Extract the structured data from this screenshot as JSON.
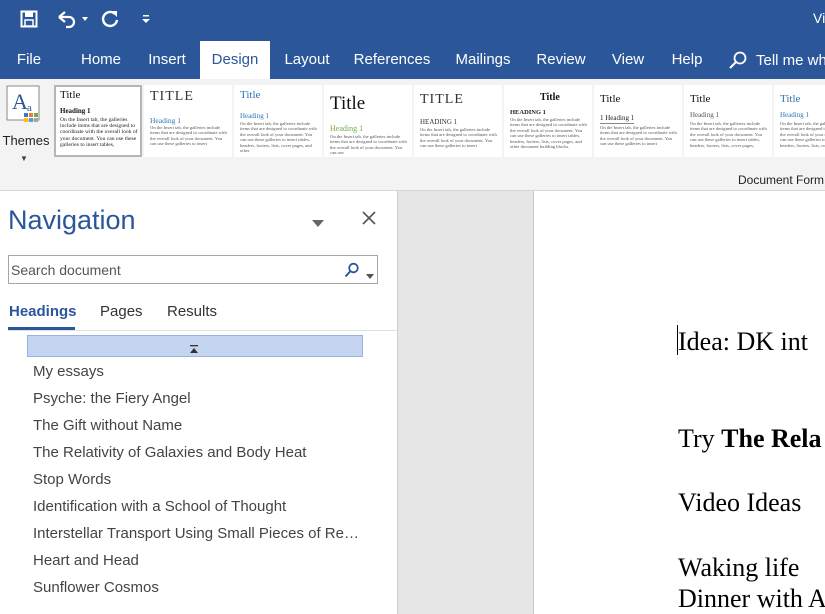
{
  "window": {
    "title": "Vi"
  },
  "quick_access": {
    "save_icon": "save-icon",
    "undo_icon": "undo-icon",
    "redo_icon": "redo-icon",
    "customize_icon": "customize-qat-icon"
  },
  "tabs": [
    {
      "label": "File"
    },
    {
      "label": "Home"
    },
    {
      "label": "Insert"
    },
    {
      "label": "Design",
      "active": true
    },
    {
      "label": "Layout"
    },
    {
      "label": "References"
    },
    {
      "label": "Mailings"
    },
    {
      "label": "Review"
    },
    {
      "label": "View"
    },
    {
      "label": "Help"
    }
  ],
  "tell_me": {
    "label": "Tell me wh"
  },
  "ribbon": {
    "themes_label": "Themes",
    "group_label": "Document Form",
    "style_gallery": [
      {
        "title": "Title",
        "heading": "Heading 1",
        "body": "On the Insert tab, the galleries include items that are designed to coordinate with the overall look of your document. You can use these galleries to insert tables,"
      },
      {
        "title": "TITLE",
        "heading": "Heading 1",
        "body": "On the Insert tab, the galleries include items that are designed to coordinate with the overall look of your document. You can use these galleries to insert"
      },
      {
        "title": "Title",
        "heading": "Heading 1",
        "body": "On the Insert tab, the galleries include items that are designed to coordinate with the overall look of your document. You can use these galleries to insert tables, headers, footers, lists, cover pages, and other"
      },
      {
        "title": "Title",
        "heading": "Heading 1",
        "body": "On the Insert tab, the galleries include items that are designed to coordinate with the overall look of your document. You can use"
      },
      {
        "title": "TITLE",
        "heading": "HEADING 1",
        "body": "On the Insert tab, the galleries include items that are designed to coordinate with the overall look of your document. You can use these galleries to insert"
      },
      {
        "title": "Title",
        "heading": "HEADING 1",
        "body": "On the Insert tab, the galleries include items that are designed to coordinate with the overall look of your document. You can use these galleries to insert tables, headers, footers, lists, cover pages, and other document building blocks."
      },
      {
        "title": "Title",
        "heading": "1 Heading 1",
        "body": "On the Insert tab, the galleries include items that are designed to coordinate with the overall look of your document. You can use these galleries to insert"
      },
      {
        "title": "Title",
        "heading": "Heading 1",
        "body": "On the Insert tab, the galleries include items that are designed to coordinate with the overall look of your document. You can use these galleries to insert tables, headers, footers, lists, cover pages,"
      },
      {
        "title": "Title",
        "heading": "Heading 1",
        "body": "On the Insert tab, the galleries include items that are designed to coordinate with the overall look of your document. You can use these galleries to insert tables, headers, footers, lists, cover pages,"
      }
    ]
  },
  "navigation": {
    "title": "Navigation",
    "search_placeholder": "Search document",
    "tabs": [
      {
        "label": "Headings",
        "active": true
      },
      {
        "label": "Pages"
      },
      {
        "label": "Results"
      }
    ],
    "headings": [
      "My essays",
      "Psyche: the Fiery Angel",
      "The Gift without Name",
      "The Relativity of Galaxies and Body Heat",
      "Stop Words",
      "Identification with a School of Thought",
      "Interstellar Transport Using Small Pieces of Rec...",
      "Heart and Head",
      "Sunflower Cosmos"
    ]
  },
  "document": {
    "line1": "Idea:  DK int",
    "line2_prefix": "Try ",
    "line2_bold": "The Rela",
    "line3": "Video Ideas",
    "line4": "Waking life",
    "line5": "Dinner with A"
  },
  "colors": {
    "accent": "#2b579a",
    "ribbon_bg": "#f3f3f3",
    "selection": "#c5d5f1"
  }
}
